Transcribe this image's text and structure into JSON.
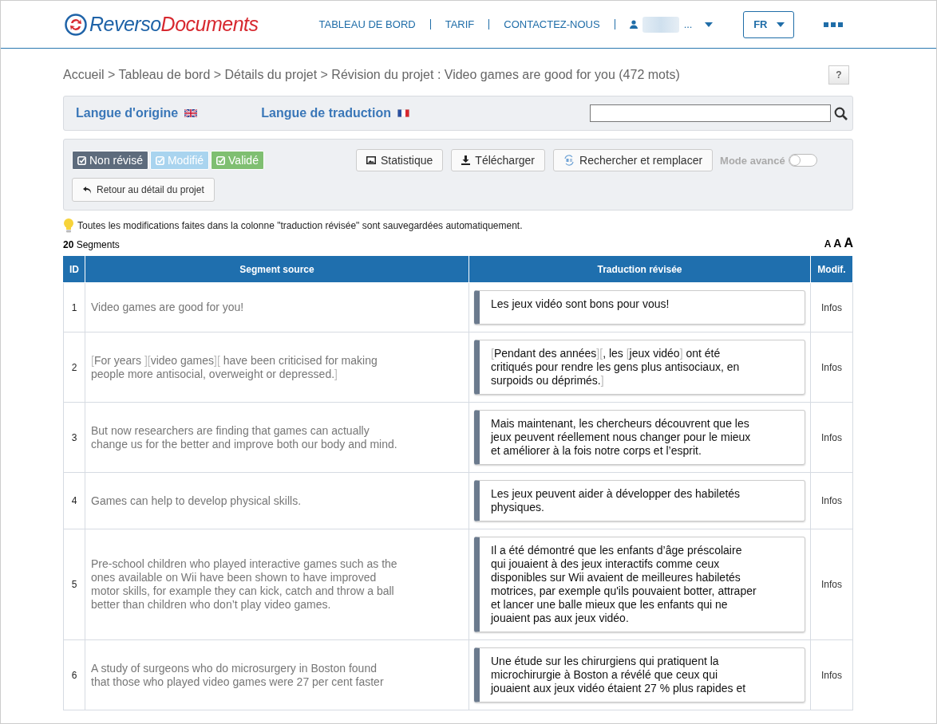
{
  "header": {
    "logo": {
      "part1": "Reverso",
      "part2": "Documents"
    },
    "nav": [
      "TABLEAU DE BORD",
      "TARIF",
      "CONTACTEZ-NOUS"
    ],
    "user": {
      "name_suffix": "..."
    },
    "language": "FR"
  },
  "breadcrumb": "Accueil > Tableau de bord > Détails du projet > Révision du projet : Video games are good for you (472 mots)",
  "help": "?",
  "languages": {
    "source": "Langue d'origine",
    "target": "Langue de traduction"
  },
  "filters": [
    {
      "label": "Non révisé",
      "color": "#5d6b7c"
    },
    {
      "label": "Modifié",
      "color": "#a9d4ef"
    },
    {
      "label": "Validé",
      "color": "#7fbf71"
    }
  ],
  "actions": [
    {
      "label": "Statistique",
      "kind": "image"
    },
    {
      "label": "Télécharger",
      "kind": "download"
    },
    {
      "label": "Rechercher et remplacer",
      "kind": "replace"
    }
  ],
  "advanced_mode": {
    "label": "Mode avancé",
    "on": false
  },
  "back_button": "Retour au détail du projet",
  "notice": "Toutes les modifications faites dans la colonne \"traduction révisée\" sont sauvegardées automatiquement.",
  "segment_count": "**20** Segments",
  "font_sizes": [
    "A",
    "A",
    "A"
  ],
  "table": {
    "columns": [
      "ID",
      "Segment source",
      "Traduction révisée",
      "Modif."
    ],
    "rows": [
      {
        "id": "1",
        "source": "Video games are good for you!",
        "translation": "Les jeux vidéo sont bons pour vous!",
        "modif": "Infos"
      },
      {
        "id": "2",
        "source": "[For years ][video games][ have been criticised for making people more antisocial, overweight or depressed.]",
        "translation": "[Pendant des années][, les [jeux vidéo] ont été critiqués pour rendre les gens plus antisociaux, en surpoids ou déprimés.]",
        "modif": "Infos"
      },
      {
        "id": "3",
        "source": "But now researchers are finding that games can actually change us for the better and improve both our body and mind.",
        "translation": "Mais maintenant, les chercheurs découvrent que les jeux peuvent réellement nous changer pour le mieux et améliorer à la fois notre corps et l’esprit.",
        "modif": "Infos"
      },
      {
        "id": "4",
        "source": "Games can help to develop physical skills.",
        "translation": "Les jeux peuvent aider à développer des habiletés physiques.",
        "modif": "Infos"
      },
      {
        "id": "5",
        "source": "Pre-school children who played interactive games such as the ones available on Wii have been shown to have improved motor skills, for example they can kick, catch and throw a ball better than children who don’t play video games.",
        "translation": "Il a été démontré que les enfants d’âge préscolaire qui jouaient à des jeux interactifs comme ceux disponibles sur Wii avaient de meilleures habiletés motrices, par exemple qu'ils pouvaient botter, attraper et lancer une balle mieux que les enfants qui ne jouaient pas aux jeux vidéo.",
        "modif": "Infos"
      },
      {
        "id": "6",
        "source": "A study of surgeons who do microsurgery in Boston found that those who played video games were 27 per cent faster",
        "translation": "Une étude sur les chirurgiens qui pratiquent la microchirurgie à Boston a révélé que ceux qui jouaient aux jeux vidéo étaient 27 % plus rapides et",
        "modif": "Infos"
      }
    ]
  }
}
